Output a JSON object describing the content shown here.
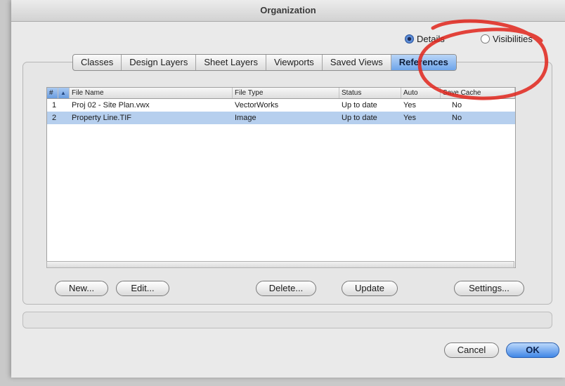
{
  "window": {
    "title": "Organization"
  },
  "view_mode": {
    "options": [
      {
        "label": "Details",
        "selected": true
      },
      {
        "label": "Visibilities",
        "selected": false
      }
    ]
  },
  "tabs": [
    {
      "label": "Classes",
      "active": false
    },
    {
      "label": "Design Layers",
      "active": false
    },
    {
      "label": "Sheet Layers",
      "active": false
    },
    {
      "label": "Viewports",
      "active": false
    },
    {
      "label": "Saved Views",
      "active": false
    },
    {
      "label": "References",
      "active": true
    }
  ],
  "table": {
    "columns": [
      {
        "key": "num",
        "label": "#"
      },
      {
        "key": "sort",
        "label": "▲"
      },
      {
        "key": "file_name",
        "label": "File Name"
      },
      {
        "key": "file_type",
        "label": "File Type"
      },
      {
        "key": "status",
        "label": "Status"
      },
      {
        "key": "auto",
        "label": "Auto"
      },
      {
        "key": "save_cache",
        "label": "Save Cache"
      }
    ],
    "rows": [
      {
        "num": "1",
        "file_name": "Proj 02 - Site Plan.vwx",
        "file_type": "VectorWorks",
        "status": "Up to date",
        "auto": "Yes",
        "save_cache": "No",
        "selected": false
      },
      {
        "num": "2",
        "file_name": "Property Line.TIF",
        "file_type": "Image",
        "status": "Up to date",
        "auto": "Yes",
        "save_cache": "No",
        "selected": true
      }
    ]
  },
  "actions": {
    "new": "New...",
    "edit": "Edit...",
    "delete": "Delete...",
    "update": "Update",
    "settings": "Settings..."
  },
  "dialog_buttons": {
    "cancel": "Cancel",
    "ok": "OK"
  },
  "colors": {
    "accent": "#3f86e6",
    "selected_row": "#b6cfee",
    "annotation": "#e0251b"
  }
}
